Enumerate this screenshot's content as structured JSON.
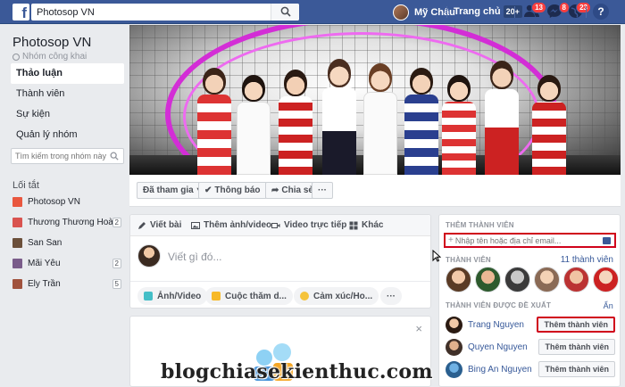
{
  "topbar": {
    "search_value": "Photosop VN",
    "user_name": "Mỹ Châu",
    "home_label": "Trang chủ",
    "home_count": "20+",
    "friend_requests_badge": "13",
    "messages_badge": "8",
    "notifications_badge": "23",
    "help_glyph": "?"
  },
  "group": {
    "name": "Photosop VN",
    "privacy": "Nhóm công khai"
  },
  "nav": [
    {
      "label": "Thảo luận",
      "active": true
    },
    {
      "label": "Thành viên"
    },
    {
      "label": "Sự kiện"
    },
    {
      "label": "Quản lý nhóm"
    }
  ],
  "side_search_placeholder": "Tìm kiếm trong nhóm này",
  "shortcuts": {
    "title": "Lối tắt",
    "items": [
      {
        "label": "Photosop VN",
        "count": "",
        "icon": "group-icon",
        "color": "#e9573f"
      },
      {
        "label": "Thương Thương Hoài",
        "count": "2",
        "icon": "group-icon",
        "color": "#d9534f"
      },
      {
        "label": "San San",
        "count": "",
        "icon": "group-icon",
        "color": "#6b4f3a"
      },
      {
        "label": "Mãi Yêu",
        "count": "2",
        "icon": "group-icon",
        "color": "#7a5c8a"
      },
      {
        "label": "Ely Trần",
        "count": "5",
        "icon": "group-icon",
        "color": "#a0523d"
      }
    ]
  },
  "cover_actions": {
    "joined": "Đã tham gia",
    "notify": "Thông báo",
    "share": "Chia sẻ",
    "more": "···"
  },
  "composer": {
    "tabs": [
      "Viết bài",
      "Thêm ảnh/video",
      "Video trực tiếp",
      "Khác"
    ],
    "placeholder": "Viết gì đó...",
    "actions": [
      "Ảnh/Video",
      "Cuộc thăm d...",
      "Cảm xúc/Ho...",
      "···"
    ]
  },
  "promo_close": "×",
  "right": {
    "add_title": "THÊM THÀNH VIÊN",
    "add_placeholder": "Nhập tên hoặc địa chỉ email...",
    "add_plus": "+",
    "members_title": "THÀNH VIÊN",
    "members_count": "11 thành viên",
    "suggested_title": "THÀNH VIÊN ĐƯỢC ĐỀ XUẤT",
    "suggested_hide": "Ẩn",
    "suggestions": [
      {
        "name": "Trang Nguyen",
        "button": "Thêm thành viên",
        "highlight": true
      },
      {
        "name": "Quyen Nguyen",
        "button": "Thêm thành viên",
        "highlight": false
      },
      {
        "name": "Bing An Nguyen",
        "button": "Thêm thành viên",
        "highlight": false
      }
    ]
  },
  "watermark": "blogchiasekienthuc.com",
  "colors": {
    "brand": "#3b5998",
    "highlight": "#d0021b",
    "link": "#365899"
  }
}
